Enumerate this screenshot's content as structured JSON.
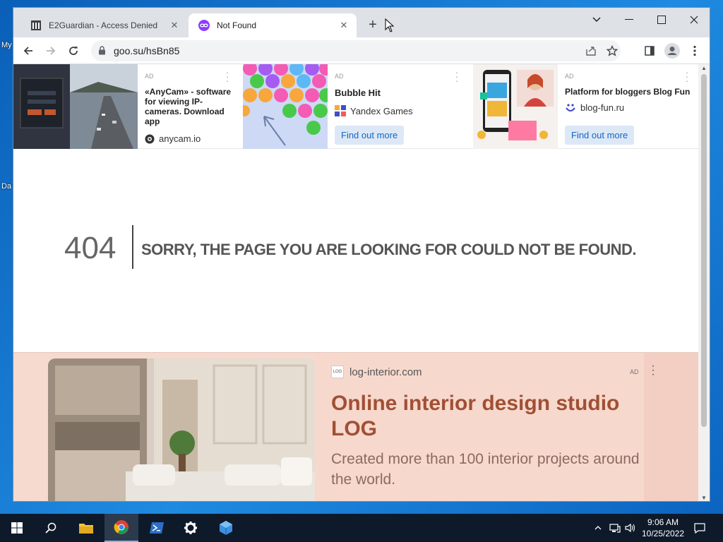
{
  "desktop": {
    "labels": [
      "My",
      "Da"
    ]
  },
  "tabs": [
    {
      "title": "E2Guardian - Access Denied",
      "icon": "building-icon"
    },
    {
      "title": "Not Found",
      "icon": "link-icon"
    }
  ],
  "address": {
    "url": "goo.su/hsBn85"
  },
  "ads": [
    {
      "tag": "AD",
      "title": "«AnyCam» - software for viewing IP-cameras. Download app",
      "domain": "anycam.io"
    },
    {
      "tag": "AD",
      "title": "Bubble Hit",
      "domain": "Yandex Games",
      "cta": "Find out more"
    },
    {
      "tag": "AD",
      "title": "Platform for bloggers Blog Fun",
      "domain": "blog-fun.ru",
      "cta": "Find out more"
    }
  ],
  "error": {
    "code": "404",
    "message": "SORRY, THE PAGE YOU ARE LOOKING FOR COULD NOT BE FOUND."
  },
  "big_ad": {
    "domain": "log-interior.com",
    "logo_text": "LOG",
    "tag": "AD",
    "title": "Online interior design studio LOG",
    "description": "Created more than 100 interior projects around the world."
  },
  "clock": {
    "time": "9:06 AM",
    "date": "10/25/2022"
  },
  "colors": {
    "accent": "#1565c0",
    "ad_bg": "#f6d9cf",
    "ad_title": "#a05035",
    "taskbar": "#0e1a2a"
  }
}
